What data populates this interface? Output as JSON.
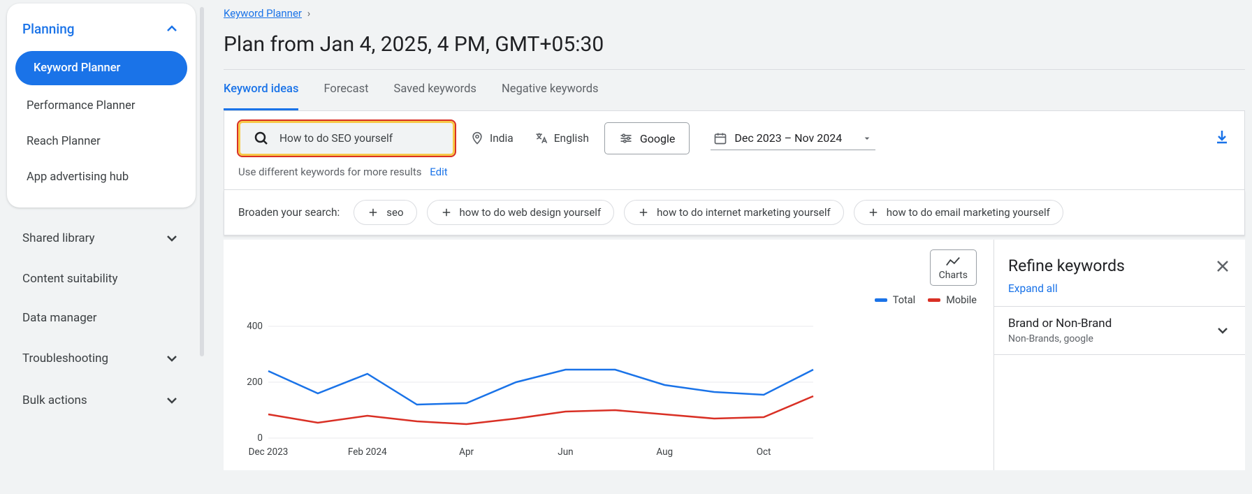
{
  "sidebar": {
    "planning_label": "Planning",
    "items": [
      "Keyword Planner",
      "Performance Planner",
      "Reach Planner",
      "App advertising hub"
    ],
    "sections": [
      "Shared library",
      "Content suitability",
      "Data manager",
      "Troubleshooting",
      "Bulk actions"
    ]
  },
  "breadcrumb": {
    "root": "Keyword Planner"
  },
  "page_title": "Plan from Jan 4, 2025, 4 PM, GMT+05:30",
  "tabs": [
    "Keyword ideas",
    "Forecast",
    "Saved keywords",
    "Negative keywords"
  ],
  "search": {
    "query": "How to do SEO yourself"
  },
  "filters": {
    "location": "India",
    "language": "English",
    "network": "Google",
    "date_range": "Dec 2023 – Nov 2024"
  },
  "hint": {
    "text": "Use different keywords for more results",
    "action": "Edit"
  },
  "broaden": {
    "label": "Broaden your search:",
    "chips": [
      "seo",
      "how to do web design yourself",
      "how to do internet marketing yourself",
      "how to do email marketing yourself"
    ]
  },
  "charts_btn": "Charts",
  "legend": {
    "total": "Total",
    "mobile": "Mobile"
  },
  "refine": {
    "title": "Refine keywords",
    "expand": "Expand all",
    "group_title": "Brand or Non-Brand",
    "group_sub": "Non-Brands, google"
  },
  "chart_data": {
    "type": "line",
    "xlabel": "",
    "ylabel": "",
    "ylim": [
      0,
      400
    ],
    "y_ticks": [
      0,
      200,
      400
    ],
    "categories": [
      "Dec 2023",
      "Jan 2024",
      "Feb 2024",
      "Mar 2024",
      "Apr",
      "May",
      "Jun",
      "Jul",
      "Aug",
      "Sep",
      "Oct",
      "Nov"
    ],
    "x_tick_labels": [
      "Dec 2023",
      "Feb 2024",
      "Apr",
      "Jun",
      "Aug",
      "Oct"
    ],
    "series": [
      {
        "name": "Total",
        "color": "#1a73e8",
        "values": [
          240,
          160,
          230,
          120,
          125,
          200,
          245,
          245,
          190,
          165,
          155,
          245
        ]
      },
      {
        "name": "Mobile",
        "color": "#d93025",
        "values": [
          85,
          55,
          80,
          60,
          50,
          70,
          95,
          100,
          85,
          70,
          75,
          150
        ]
      }
    ]
  }
}
